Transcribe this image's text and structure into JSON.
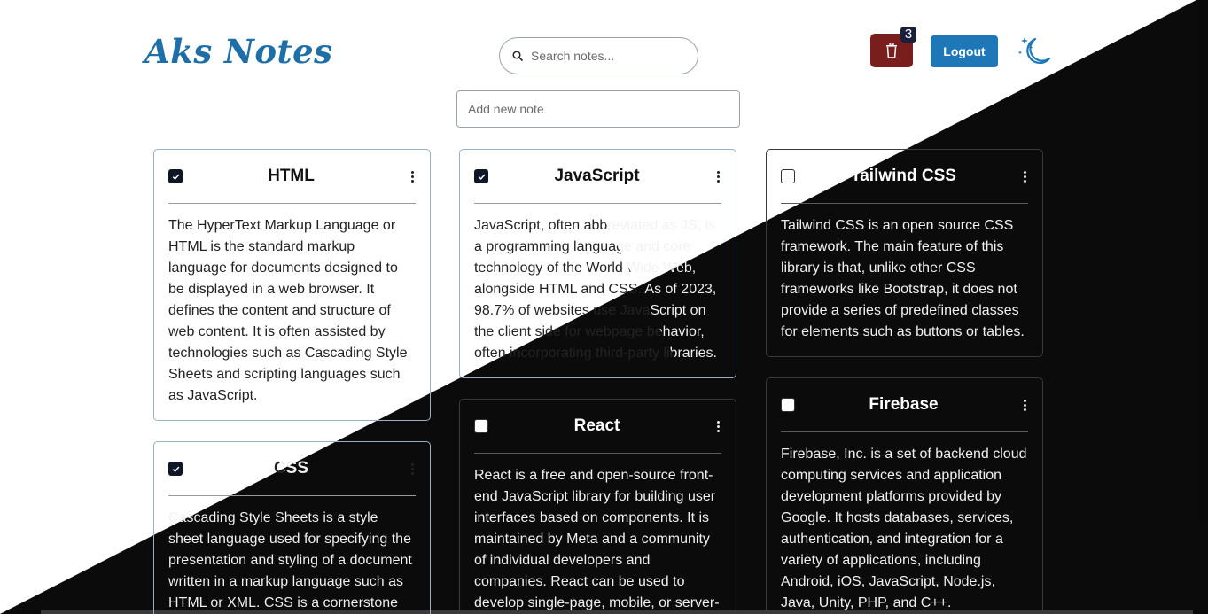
{
  "header": {
    "app_title": "Aks Notes",
    "search_placeholder": "Search notes...",
    "trash_count": "3",
    "logout_label": "Logout"
  },
  "add_note": {
    "placeholder": "Add new note"
  },
  "notes": [
    {
      "title": "HTML",
      "checked": true,
      "body": "The HyperText Markup Language or HTML is the standard markup language for documents designed to be displayed in a web browser. It defines the content and structure of web content. It is often assisted by technologies such as Cascading Style Sheets and scripting languages such as JavaScript."
    },
    {
      "title": "CSS",
      "checked": true,
      "body": "Cascading Style Sheets is a style sheet language used for specifying the presentation and styling of a document written in a markup language such as HTML or XML. CSS is a cornerstone"
    },
    {
      "title": "JavaScript",
      "checked": true,
      "body": "JavaScript, often abbreviated as JS, is a programming language and core technology of the World Wide Web, alongside HTML and CSS. As of 2023, 98.7% of websites use JavaScript on the client side for webpage behavior, often incorporating third-party libraries."
    },
    {
      "title": "React",
      "checked": false,
      "body": "React is a free and open-source front-end JavaScript library for building user interfaces based on components. It is maintained by Meta and a community of individual developers and companies. React can be used to develop single-page, mobile, or server-"
    },
    {
      "title": "Tailwind CSS",
      "checked": false,
      "body": "Tailwind CSS is an open source CSS framework. The main feature of this library is that, unlike other CSS frameworks like Bootstrap, it does not provide a series of predefined classes for elements such as buttons or tables."
    },
    {
      "title": "Firebase",
      "checked": false,
      "body": "Firebase, Inc. is a set of backend cloud computing services and application development platforms provided by Google. It hosts databases, services, authentication, and integration for a variety of applications, including Android, iOS, JavaScript, Node.js, Java, Unity, PHP, and C++."
    }
  ],
  "colors": {
    "brand": "#1e6fa8",
    "logout": "#1e78b8",
    "trash": "#7a1d1d",
    "dark_bg": "#0b0b0c"
  },
  "icons": [
    "search-icon",
    "trash-icon",
    "moon-stars-icon",
    "check-icon",
    "kebab-menu-icon"
  ]
}
